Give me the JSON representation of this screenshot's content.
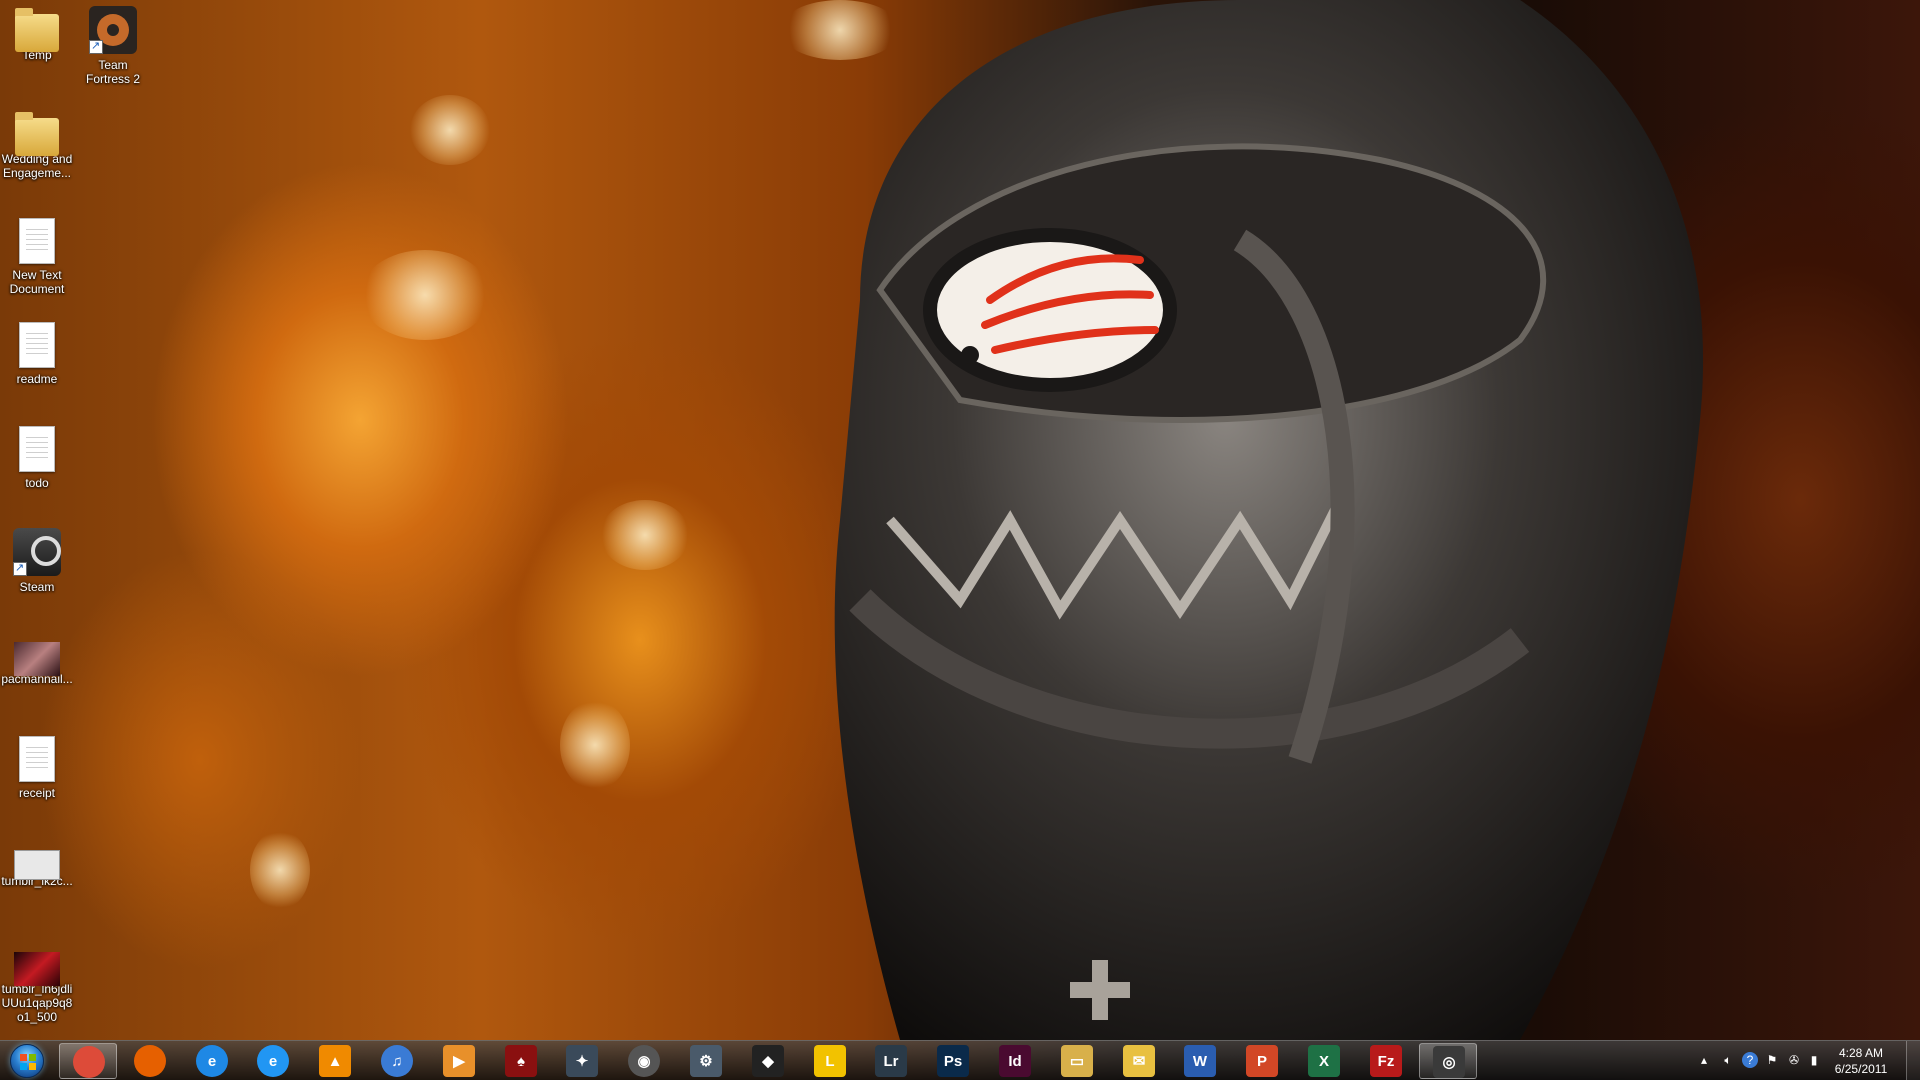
{
  "desktop": {
    "icons": [
      {
        "label": "Temp",
        "icon": "folder-icon"
      },
      {
        "label": "Team Fortress 2",
        "icon": "team-fortress-2-icon"
      },
      {
        "label": "Wedding and Engageme...",
        "icon": "folder-icon"
      },
      {
        "label": "New Text Document",
        "icon": "text-document-icon"
      },
      {
        "label": "readme",
        "icon": "text-document-icon"
      },
      {
        "label": "todo",
        "icon": "text-document-icon"
      },
      {
        "label": "Steam",
        "icon": "steam-icon"
      },
      {
        "label": "pacmannail...",
        "icon": "image-file-icon"
      },
      {
        "label": "receipt",
        "icon": "document-icon"
      },
      {
        "label": "tumblr_lk2c...",
        "icon": "image-file-icon"
      },
      {
        "label": "tumblr_ln6jdliUUu1qap9q8o1_500",
        "icon": "image-file-icon"
      }
    ]
  },
  "taskbar": {
    "pinned": [
      {
        "name": "chrome",
        "glyph": "",
        "color": "#dd4b39",
        "active": true
      },
      {
        "name": "firefox",
        "glyph": "",
        "color": "#e66000",
        "active": false
      },
      {
        "name": "internet-explorer",
        "glyph": "e",
        "color": "#1e88e5",
        "active": false
      },
      {
        "name": "internet-explorer-2",
        "glyph": "e",
        "color": "#2196f3",
        "active": false
      },
      {
        "name": "vlc",
        "glyph": "▲",
        "color": "#f08a00",
        "active": false
      },
      {
        "name": "itunes",
        "glyph": "♫",
        "color": "#3a7bd5",
        "active": false
      },
      {
        "name": "media-player",
        "glyph": "▶",
        "color": "#e8902a",
        "active": false
      },
      {
        "name": "app-red-logo",
        "glyph": "♠",
        "color": "#8a1010",
        "active": false
      },
      {
        "name": "starcraft",
        "glyph": "✦",
        "color": "#3a4a5a",
        "active": false
      },
      {
        "name": "app-circle",
        "glyph": "◉",
        "color": "#555555",
        "active": false
      },
      {
        "name": "app-robot",
        "glyph": "⚙",
        "color": "#4a5a6a",
        "active": false
      },
      {
        "name": "app-shield",
        "glyph": "◆",
        "color": "#222222",
        "active": false
      },
      {
        "name": "logo-creator",
        "glyph": "L",
        "color": "#f2c200",
        "active": false
      },
      {
        "name": "lightroom",
        "glyph": "Lr",
        "color": "#2a3a48",
        "active": false
      },
      {
        "name": "photoshop",
        "glyph": "Ps",
        "color": "#0a2a4a",
        "active": false
      },
      {
        "name": "indesign",
        "glyph": "Id",
        "color": "#4a0a30",
        "active": false
      },
      {
        "name": "windows-explorer",
        "glyph": "▭",
        "color": "#d8b04a",
        "active": false
      },
      {
        "name": "mail",
        "glyph": "✉",
        "color": "#e8c040",
        "active": false
      },
      {
        "name": "word",
        "glyph": "W",
        "color": "#2a5db0",
        "active": false
      },
      {
        "name": "powerpoint",
        "glyph": "P",
        "color": "#d24726",
        "active": false
      },
      {
        "name": "excel",
        "glyph": "X",
        "color": "#1e7145",
        "active": false
      },
      {
        "name": "filezilla",
        "glyph": "Fz",
        "color": "#b81a1a",
        "active": false
      },
      {
        "name": "steam",
        "glyph": "◎",
        "color": "#3a3a3a",
        "active": true
      }
    ],
    "tray": {
      "icons": [
        "show-hidden-icons-arrow",
        "volume-icon",
        "help-icon",
        "action-center-flag-icon",
        "network-icon",
        "signal-icon"
      ],
      "time": "4:28 AM",
      "date": "6/25/2011"
    }
  }
}
